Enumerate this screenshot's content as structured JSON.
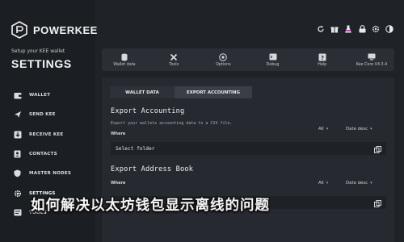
{
  "app": {
    "brand": "POWERKEE",
    "subtitle": "Setup your KEE wallet",
    "heading": "SETTINGS"
  },
  "sidebar": {
    "items": [
      {
        "label": "WALLET",
        "icon": "wallet-icon"
      },
      {
        "label": "SEND KEE",
        "icon": "send-icon"
      },
      {
        "label": "RECEIVE KEE",
        "icon": "receive-icon"
      },
      {
        "label": "CONTACTS",
        "icon": "contacts-icon"
      },
      {
        "label": "MASTER NODES",
        "icon": "shield-icon"
      },
      {
        "label": "SETTINGS",
        "icon": "gear-icon"
      },
      {
        "label": "TOOLS",
        "icon": "tools-icon"
      }
    ]
  },
  "topbar": {
    "icons": [
      "refresh-icon",
      "gift-icon",
      "flask-icon",
      "lock-icon",
      "settings-icon",
      "brightness-icon"
    ]
  },
  "toolbar": {
    "items": [
      {
        "label": "Wallet data",
        "icon": "database-icon"
      },
      {
        "label": "Tools",
        "icon": "tools-icon"
      },
      {
        "label": "Options",
        "icon": "options-icon"
      },
      {
        "label": "Debug",
        "icon": "debug-icon"
      },
      {
        "label": "Help",
        "icon": "help-icon"
      },
      {
        "label": "Kee Core V4.3.4",
        "icon": "monitor-icon"
      }
    ]
  },
  "tabs": [
    "WALLET DATA",
    "EXPORT ACCOUNTING"
  ],
  "export_accounting": {
    "title": "Export Accounting",
    "description": "Export your wallets accounting data to a CSV file.",
    "where_label": "Where",
    "filter_all": "All",
    "sort": "Date desc",
    "folder_placeholder": "Select folder"
  },
  "export_address_book": {
    "title": "Export Address Book",
    "where_label": "Where",
    "filter_all": "All",
    "sort": "Date desc",
    "folder_placeholder": "Select folder"
  },
  "overlay": {
    "text": "如何解决以太坊钱包显示离线的问题"
  },
  "colors": {
    "background": "#1f2227",
    "panel": "#262a30",
    "toolbar": "#2b2f35",
    "active_tab": "#3a3f47"
  }
}
